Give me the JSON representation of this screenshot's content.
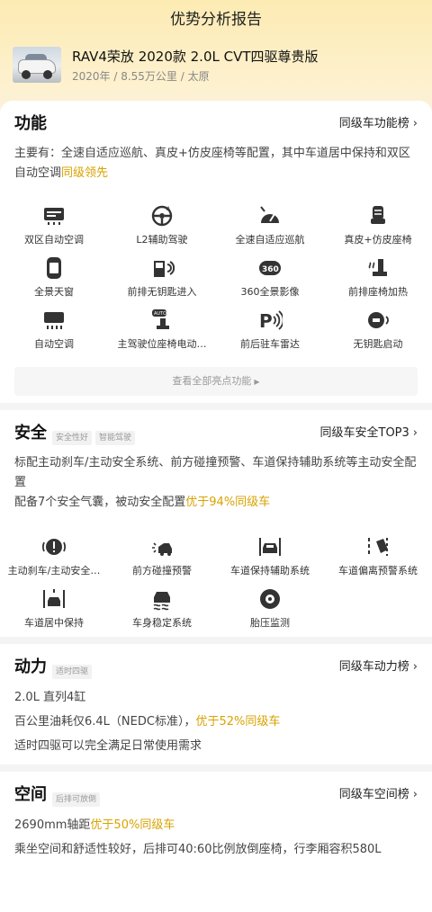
{
  "header": {
    "title": "优势分析报告"
  },
  "car": {
    "name": "RAV4荣放 2020款 2.0L CVT四驱尊贵版",
    "meta": "2020年 / 8.55万公里 / 太原"
  },
  "function": {
    "title": "功能",
    "rank": "同级车功能榜",
    "desc_main": "主要有：全速自适应巡航、真皮+仿皮座椅等配置，其中车道居中保持和双区自动空调",
    "desc_highlight": "同级领先",
    "items": [
      {
        "label": "双区自动空调",
        "icon": "dual-zone-ac-icon"
      },
      {
        "label": "L2辅助驾驶",
        "icon": "l2-assist-icon"
      },
      {
        "label": "全速自适应巡航",
        "icon": "adaptive-cruise-icon"
      },
      {
        "label": "真皮+仿皮座椅",
        "icon": "leather-seat-icon"
      },
      {
        "label": "全景天窗",
        "icon": "sunroof-icon"
      },
      {
        "label": "前排无钥匙进入",
        "icon": "keyless-entry-icon"
      },
      {
        "label": "360全景影像",
        "icon": "camera-360-icon"
      },
      {
        "label": "前排座椅加热",
        "icon": "seat-heating-icon"
      },
      {
        "label": "自动空调",
        "icon": "auto-ac-icon"
      },
      {
        "label": "主驾驶位座椅电动…",
        "icon": "power-seat-icon"
      },
      {
        "label": "前后驻车雷达",
        "icon": "parking-radar-icon"
      },
      {
        "label": "无钥匙启动",
        "icon": "keyless-start-icon"
      }
    ],
    "more": "查看全部亮点功能"
  },
  "safety": {
    "title": "安全",
    "tags": [
      "安全性好",
      "智能驾驶"
    ],
    "rank": "同级车安全TOP3",
    "desc1": "标配主动刹车/主动安全系统、前方碰撞预警、车道保持辅助系统等主动安全配置",
    "desc2_main": "配备7个安全气囊，被动安全配置",
    "desc2_highlight": "优于94%同级车",
    "items": [
      {
        "label": "主动刹车/主动安全…",
        "icon": "active-brake-icon"
      },
      {
        "label": "前方碰撞预警",
        "icon": "collision-warning-icon"
      },
      {
        "label": "车道保持辅助系统",
        "icon": "lane-keep-icon"
      },
      {
        "label": "车道偏离预警系统",
        "icon": "lane-departure-icon"
      },
      {
        "label": "车道居中保持",
        "icon": "lane-center-icon"
      },
      {
        "label": "车身稳定系统",
        "icon": "stability-icon"
      },
      {
        "label": "胎压监测",
        "icon": "tire-pressure-icon"
      }
    ]
  },
  "power": {
    "title": "动力",
    "tags": [
      "适时四驱"
    ],
    "rank": "同级车动力榜",
    "line1": "2.0L 直列4缸",
    "line2_main": "百公里油耗仅6.4L（NEDC标准），",
    "line2_highlight": "优于52%同级车",
    "line3": "适时四驱可以完全满足日常使用需求"
  },
  "space": {
    "title": "空间",
    "tags": [
      "后排可放倒"
    ],
    "rank": "同级车空间榜",
    "line1_main": "2690mm轴距",
    "line1_highlight": "优于50%同级车",
    "line2": "乘坐空间和舒适性较好，后排可40:60比例放倒座椅，行李厢容积580L"
  },
  "colors": {
    "accent": "#d9a200",
    "hero_top": "#fdebb3",
    "icon": "#333333"
  }
}
